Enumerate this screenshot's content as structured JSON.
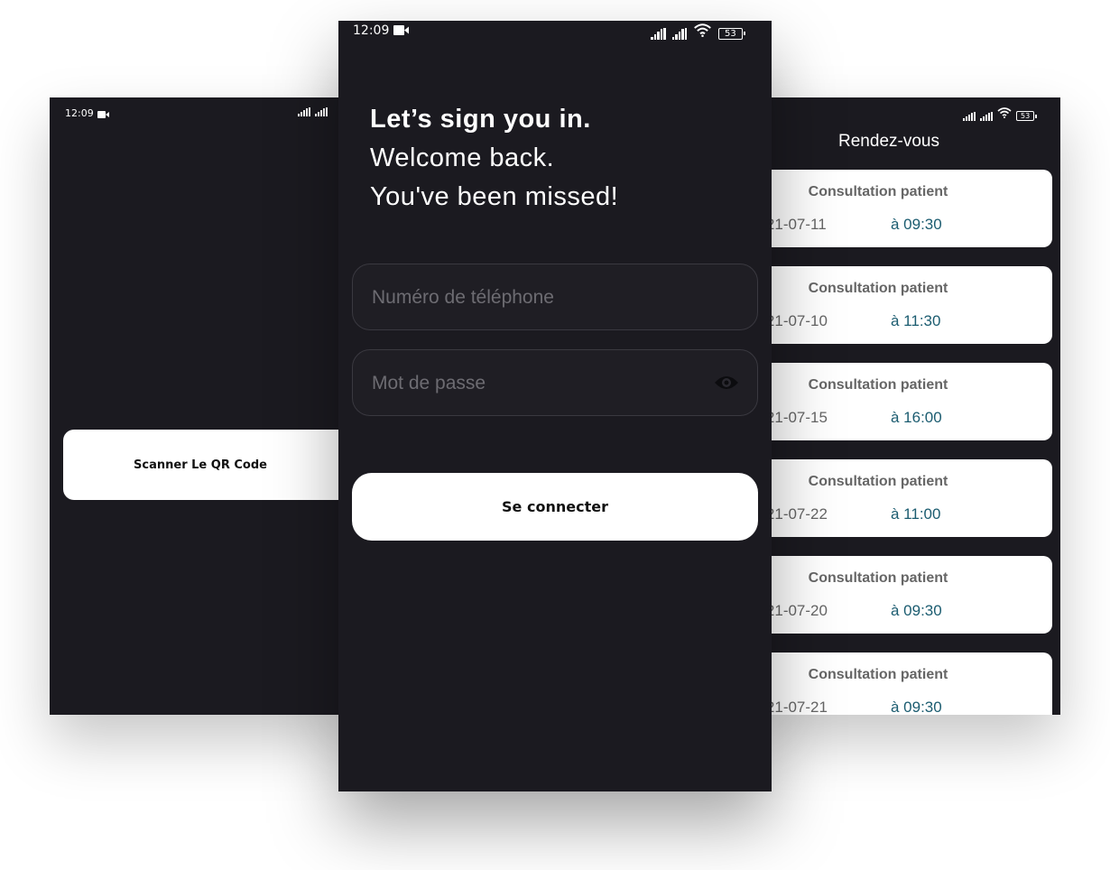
{
  "status": {
    "time": "12:09",
    "battery": "53"
  },
  "left_screen": {
    "scan_button_label": "Scanner Le QR Code"
  },
  "login_screen": {
    "headline_bold": "Let’s sign you in.",
    "headline_line2": "Welcome back.",
    "headline_line3": "You've been missed!",
    "phone_placeholder": "Numéro de téléphone",
    "password_placeholder": "Mot de passe",
    "login_button_label": "Se connecter"
  },
  "appointments_screen": {
    "title": "Rendez-vous",
    "items": [
      {
        "title": "Consultation patient",
        "date": "2021-07-11",
        "time": "à 09:30"
      },
      {
        "title": "Consultation patient",
        "date": "2021-07-10",
        "time": "à 11:30"
      },
      {
        "title": "Consultation patient",
        "date": "2021-07-15",
        "time": "à 16:00"
      },
      {
        "title": "Consultation patient",
        "date": "2021-07-22",
        "time": "à 11:00"
      },
      {
        "title": "Consultation patient",
        "date": "2021-07-20",
        "time": "à 09:30"
      },
      {
        "title": "Consultation patient",
        "date": "2021-07-21",
        "time": "à 09:30"
      }
    ]
  },
  "colors": {
    "background": "#1b1a20",
    "accent_time": "#1b5c70"
  }
}
